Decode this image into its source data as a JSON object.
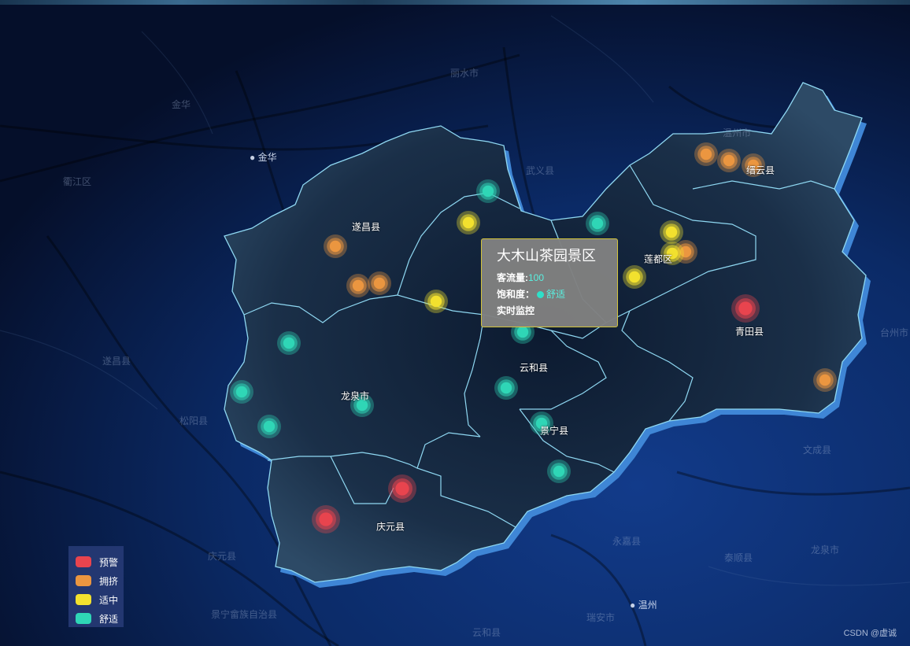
{
  "colors": {
    "warning": "#e8444e",
    "crowded": "#eb9640",
    "moderate": "#f2e12e",
    "comfortable": "#2fd6b6",
    "region_fill": "#1c3550",
    "region_border": "#8fd8f2"
  },
  "background_places": [
    "金华",
    "武义县",
    "衢江区",
    "丽水市",
    "遂昌县",
    "松阳县",
    "龙泉市",
    "庆元县",
    "温州市",
    "永嘉县",
    "文成县",
    "泰顺县",
    "瑞安市",
    "台州市",
    "景宁畲族自治县",
    "云和县"
  ],
  "background_cities": [
    {
      "name": "金华"
    },
    {
      "name": "温州"
    }
  ],
  "counties": [
    {
      "name": "遂昌县"
    },
    {
      "name": "缙云县"
    },
    {
      "name": "莲都区"
    },
    {
      "name": "青田县"
    },
    {
      "name": "云和县"
    },
    {
      "name": "龙泉市"
    },
    {
      "name": "景宁县"
    },
    {
      "name": "庆元县"
    }
  ],
  "markers": [
    {
      "status": "crowded"
    },
    {
      "status": "crowded"
    },
    {
      "status": "crowded"
    },
    {
      "status": "moderate"
    },
    {
      "status": "moderate"
    },
    {
      "status": "crowded"
    },
    {
      "status": "moderate"
    },
    {
      "status": "comfortable"
    },
    {
      "status": "comfortable"
    },
    {
      "status": "moderate"
    },
    {
      "status": "crowded"
    },
    {
      "status": "crowded"
    },
    {
      "status": "crowded"
    },
    {
      "status": "moderate"
    },
    {
      "status": "warning"
    },
    {
      "status": "comfortable"
    },
    {
      "status": "comfortable"
    },
    {
      "status": "comfortable"
    },
    {
      "status": "comfortable"
    },
    {
      "status": "comfortable"
    },
    {
      "status": "comfortable"
    },
    {
      "status": "comfortable"
    },
    {
      "status": "comfortable"
    },
    {
      "status": "crowded"
    },
    {
      "status": "warning"
    },
    {
      "status": "warning"
    }
  ],
  "tooltip": {
    "title": "大木山茶园景区",
    "visitors_label": "客流量:",
    "visitors_value": "100",
    "saturation_label": "饱和度：",
    "saturation_value": "舒适",
    "link_label": "实时监控"
  },
  "legend": [
    {
      "label": "预警",
      "color": "#e8444e"
    },
    {
      "label": "拥挤",
      "color": "#eb9640"
    },
    {
      "label": "适中",
      "color": "#f2e12e"
    },
    {
      "label": "舒适",
      "color": "#2fd6b6"
    }
  ],
  "watermark": "CSDN @虚诚"
}
